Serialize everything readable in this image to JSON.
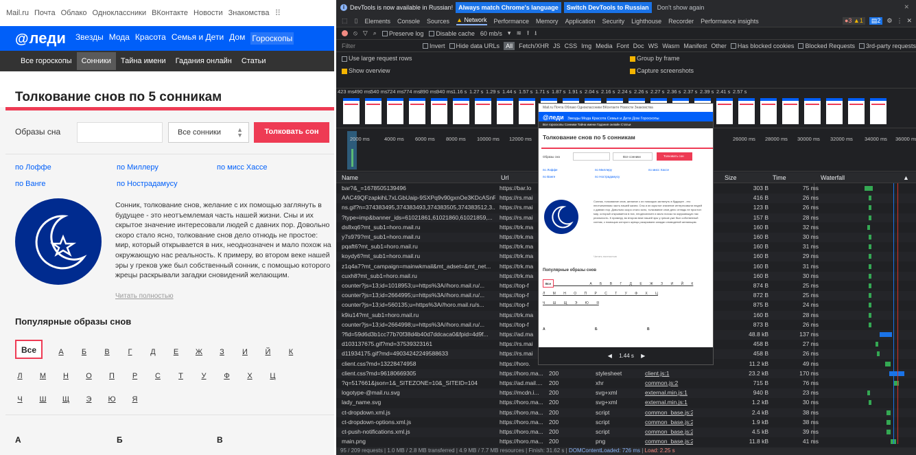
{
  "site": {
    "topbar": [
      "Mail.ru",
      "Почта",
      "Облако",
      "Одноклассники",
      "ВКонтакте",
      "Новости",
      "Знакомства"
    ],
    "logo": "леди",
    "mainnav": [
      "Звезды",
      "Мода",
      "Красота",
      "Семья и Дети",
      "Дом",
      "Гороскопы"
    ],
    "subnav": [
      "Все гороскопы",
      "Сонники",
      "Тайна имени",
      "Гадания онлайн",
      "Статьи"
    ],
    "title": "Толкование снов по 5 сонникам",
    "form": {
      "label": "Образы сна",
      "select": "Все сонники",
      "button": "Толковать сон"
    },
    "links": [
      "по Лоффе",
      "по Миллеру",
      "по мисс Хассе",
      "по Ванге",
      "по Нострадамусу"
    ],
    "description": "Сонник, толкование снов, желание с их помощью заглянуть в будущее - это неотъемлемая часть нашей жизни. Сны и их скрытое значение интересовали людей с давних пор. Довольно скоро стало ясно, толкование снов дело отнюдь не простое: мир, который открывается в них, неоднозначен и мало похож на окружающую нас реальность. К примеру, во втором веке нашей эры у греков уже был собственный сонник, с помощью которого жрецы раскрывали загадки сновидений желающим.",
    "read_more": "Читать полностью",
    "popular_title": "Популярные образы снов",
    "all_label": "Все",
    "letters_row1": [
      "А",
      "Б",
      "В",
      "Г",
      "Д",
      "Е",
      "Ж",
      "З",
      "И",
      "Й",
      "К"
    ],
    "letters_row2": [
      "Л",
      "М",
      "Н",
      "О",
      "П",
      "Р",
      "С",
      "Т",
      "У",
      "Ф",
      "Х",
      "Ц"
    ],
    "letters_row3": [
      "Ч",
      "Ш",
      "Щ",
      "Э",
      "Ю",
      "Я"
    ],
    "columns": [
      "А",
      "Б",
      "В"
    ]
  },
  "devtools": {
    "banner": {
      "text": "DevTools is now available in Russian!",
      "btn1": "Always match Chrome's language",
      "btn2": "Switch DevTools to Russian",
      "dismiss": "Don't show again"
    },
    "tabs": [
      "Elements",
      "Console",
      "Sources",
      "Network",
      "Performance",
      "Memory",
      "Application",
      "Security",
      "Lighthouse",
      "Recorder",
      "Performance insights"
    ],
    "active_tab": "Network",
    "counts": {
      "errors": "3",
      "warnings": "1",
      "messages": "2"
    },
    "toolbar": {
      "preserve": "Preserve log",
      "disable_cache": "Disable cache",
      "throttle": "60 mb/s"
    },
    "filter": {
      "placeholder": "Filter",
      "invert": "Invert",
      "hide_data": "Hide data URLs",
      "types": [
        "All",
        "Fetch/XHR",
        "JS",
        "CSS",
        "Img",
        "Media",
        "Font",
        "Doc",
        "WS",
        "Wasm",
        "Manifest",
        "Other"
      ],
      "blocked_cookies": "Has blocked cookies",
      "blocked_requests": "Blocked Requests",
      "third_party": "3rd-party requests"
    },
    "options": {
      "large_rows": "Use large request rows",
      "group_frame": "Group by frame",
      "overview": "Show overview",
      "screenshots": "Capture screenshots"
    },
    "timeline_labels": [
      "423 ms",
      "490 ms",
      "540 ms",
      "724 ms",
      "774 ms",
      "890 ms",
      "940 ms",
      "1.16 s",
      "1.27 s",
      "1.29 s",
      "1.44 s",
      "1.57 s",
      "1.71 s",
      "1.87 s",
      "1.91 s",
      "2.04 s",
      "2.16 s",
      "2.24 s",
      "2.26 s",
      "2.27 s",
      "2.36 s",
      "2.37 s",
      "2.39 s",
      "2.41 s",
      "2.57 s"
    ],
    "overview_labels": [
      "2000 ms",
      "4000 ms",
      "6000 ms",
      "8000 ms",
      "10000 ms",
      "12000 ms",
      "26000 ms",
      "28000 ms",
      "30000 ms",
      "32000 ms",
      "34000 ms",
      "36000 ms"
    ],
    "columns": {
      "name": "Name",
      "url": "Url",
      "size": "Size",
      "time": "Time",
      "waterfall": "Waterfall"
    },
    "rows": [
      {
        "name": "bar?&_=1678505139496",
        "url": "https://bar.lo",
        "status": "",
        "type": "",
        "init": "",
        "size": "303 B",
        "time": "75 ms"
      },
      {
        "name": "AAC49QFzapkihL7xLGbUaip-9SXPq9v90gxnOe3KDcASnR...",
        "url": "https://rs.mai",
        "status": "",
        "type": "",
        "init": "",
        "size": "416 B",
        "time": "26 ms"
      },
      {
        "name": "ns.gif?n=374383495,374383493,374383505,374383512,3...",
        "url": "https://rs.mai",
        "status": "",
        "type": "",
        "init": "",
        "size": "123 B",
        "time": "26 ms"
      },
      {
        "name": "?type=imp&banner_ids=61021861,61021860,61021859,...",
        "url": "https://rs.mai",
        "status": "",
        "type": "",
        "init": "",
        "size": "157 B",
        "time": "28 ms"
      },
      {
        "name": "ds8xq6?mt_sub1=horo.mail.ru",
        "url": "https://trk.ma",
        "status": "",
        "type": "",
        "init": "",
        "size": "160 B",
        "time": "32 ms"
      },
      {
        "name": "y7s979?mt_sub1=horo.mail.ru",
        "url": "https://trk.ma",
        "status": "",
        "type": "",
        "init": "",
        "size": "160 B",
        "time": "30 ms"
      },
      {
        "name": "pqaft6?mt_sub1=horo.mail.ru",
        "url": "https://trk.ma",
        "status": "",
        "type": "",
        "init": "",
        "size": "160 B",
        "time": "31 ms"
      },
      {
        "name": "koydy6?mt_sub1=horo.mail.ru",
        "url": "https://trk.ma",
        "status": "",
        "type": "",
        "init": "",
        "size": "160 B",
        "time": "29 ms"
      },
      {
        "name": "z1q4a7?mt_campaign=mainwkmail&mt_adset=&mt_net...",
        "url": "https://trk.ma",
        "status": "",
        "type": "",
        "init": "",
        "size": "160 B",
        "time": "31 ms"
      },
      {
        "name": "cuxh8?mt_sub1=horo.mail.ru",
        "url": "https://trk.ma",
        "status": "",
        "type": "",
        "init": "",
        "size": "160 B",
        "time": "30 ms"
      },
      {
        "name": "counter?js=13;id=1018953;u=https%3A//horo.mail.ru/...",
        "url": "https://top-f",
        "status": "",
        "type": "",
        "init": "",
        "size": "874 B",
        "time": "25 ms"
      },
      {
        "name": "counter?js=13;id=2664995;u=https%3A//horo.mail.ru/...",
        "url": "https://top-f",
        "status": "",
        "type": "",
        "init": "",
        "size": "872 B",
        "time": "25 ms"
      },
      {
        "name": "counter?js=13;id=560135;u=https%3A//horo.mail.ru/s...",
        "url": "https://top-f",
        "status": "",
        "type": "",
        "init": "",
        "size": "875 B",
        "time": "24 ms"
      },
      {
        "name": "k9iu14?mt_sub1=horo.mail.ru",
        "url": "https://trk.ma",
        "status": "",
        "type": "",
        "init": "",
        "size": "160 B",
        "time": "28 ms"
      },
      {
        "name": "counter?js=13;id=2664998;u=https%3A//horo.mail.ru/...",
        "url": "https://top-f",
        "status": "",
        "type": "",
        "init": "",
        "size": "873 B",
        "time": "26 ms"
      },
      {
        "name": "?fid=59d6d3b1cc77b70f38d4b40d7ddcaca0&fpid=4d9f...",
        "url": "https://ad.ma",
        "status": "",
        "type": "",
        "init": "",
        "size": "48.8 kB",
        "time": "137 ms"
      },
      {
        "name": "d103137675.gif?md=37539323161",
        "url": "https://rs.mai",
        "status": "",
        "type": "",
        "init": "",
        "size": "458 B",
        "time": "27 ms"
      },
      {
        "name": "d11934175.gif?md=49034242249588633",
        "url": "https://rs.mai",
        "status": "",
        "type": "",
        "init": "",
        "size": "458 B",
        "time": "26 ms"
      },
      {
        "name": "client.css?md=13228474958",
        "url": "https://horo.",
        "status": "",
        "type": "",
        "init": "",
        "size": "11.2 kB",
        "time": "49 ms"
      },
      {
        "name": "client.css?md=96180669305",
        "url": "https://horo.ma...",
        "status": "200",
        "type": "stylesheet",
        "init": "client.js:1",
        "size": "23.2 kB",
        "time": "170 ms"
      },
      {
        "name": "?q=517661&json=1&_SITEZONE=10&_SITEID=104",
        "url": "https://ad.mail....",
        "status": "200",
        "type": "xhr",
        "init": "common.js:2",
        "size": "715 B",
        "time": "76 ms"
      },
      {
        "name": "logotype-@mail.ru.svg",
        "url": "https://mcdn.i...",
        "status": "200",
        "type": "svg+xml",
        "init": "external.min.js:1",
        "size": "940 B",
        "time": "23 ms"
      },
      {
        "name": "lady_name.svg",
        "url": "https://horo.ma...",
        "status": "200",
        "type": "svg+xml",
        "init": "external.min.js:1",
        "size": "1.2 kB",
        "time": "30 ms"
      },
      {
        "name": "ct-dropdown.xml.js",
        "url": "https://horo.ma...",
        "status": "200",
        "type": "script",
        "init": "common_base.js:2",
        "size": "2.4 kB",
        "time": "38 ms"
      },
      {
        "name": "ct-dropdown-options.xml.js",
        "url": "https://horo.ma...",
        "status": "200",
        "type": "script",
        "init": "common_base.js:2",
        "size": "1.9 kB",
        "time": "38 ms"
      },
      {
        "name": "ct-push-notifications.xml.js",
        "url": "https://horo.ma...",
        "status": "200",
        "type": "script",
        "init": "common_base.js:2",
        "size": "4.5 kB",
        "time": "39 ms"
      },
      {
        "name": "main.png",
        "url": "https://horo.ma...",
        "status": "200",
        "type": "png",
        "init": "common_base.js:2",
        "size": "11.8 kB",
        "time": "41 ms"
      }
    ],
    "statusbar": {
      "requests": "95 / 209 requests",
      "transferred": "1.0 MB / 2.8 MB transferred",
      "resources": "4.9 MB / 7.7 MB resources",
      "finish": "Finish: 31.62 s",
      "dcl": "DOMContentLoaded: 726 ms",
      "load": "Load: 2.25 s"
    },
    "preview": {
      "time": "1.44 s",
      "topbar": "Mail.ru Почта Облако Одноклассники ВКонтакте Новости Знакомства"
    }
  }
}
